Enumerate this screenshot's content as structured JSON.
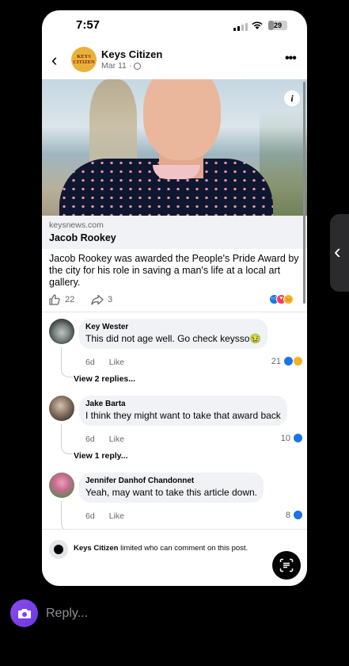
{
  "status": {
    "time": "7:57",
    "battery": "29"
  },
  "header": {
    "page_name": "Keys Citizen",
    "date": "Mar 11 ·",
    "logo_text": "KEYS CITIZEN"
  },
  "link": {
    "source": "keysnews.com",
    "title": "Jacob Rookey"
  },
  "post": {
    "text": "Jacob Rookey was awarded the People's Pride Award by the city for his role in saving a man's life at a local art gallery.",
    "likes": "22",
    "shares": "3"
  },
  "comments": [
    {
      "name": "Key Wester",
      "text": "This did not age well. Go check keysso🤢",
      "time": "6d",
      "like": "Like",
      "count": "21",
      "replies": "View 2 replies..."
    },
    {
      "name": "Jake Barta",
      "text": "I think they might want to take that award back",
      "time": "6d",
      "like": "Like",
      "count": "10",
      "replies": "View 1 reply..."
    },
    {
      "name": "Jennifer Danhof Chandonnet",
      "text": "Yeah, may want to take this article down.",
      "time": "6d",
      "like": "Like",
      "count": "8"
    }
  ],
  "restriction": {
    "page": "Keys Citizen",
    "text": "limited who can comment on this post."
  },
  "reply": {
    "placeholder": "Reply..."
  },
  "colors": {
    "accent": "#1b74e4",
    "camera": "#7c44ea"
  }
}
